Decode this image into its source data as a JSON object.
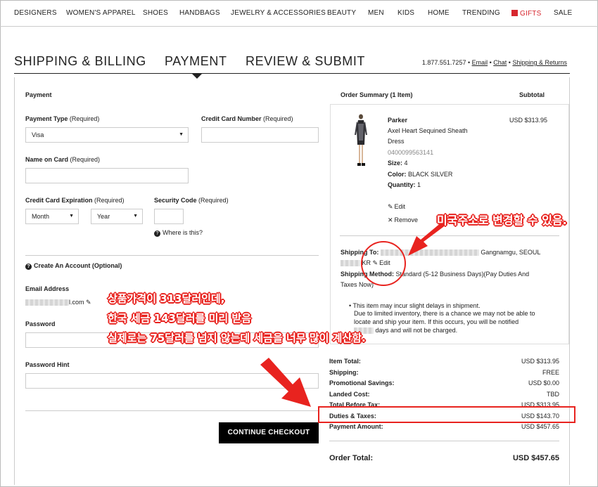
{
  "nav": {
    "items": [
      "DESIGNERS",
      "WOMEN'S APPAREL",
      "SHOES",
      "HANDBAGS",
      "JEWELRY & ACCESSORIES",
      "BEAUTY",
      "MEN",
      "KIDS",
      "HOME",
      "TRENDING"
    ],
    "gifts": "GIFTS",
    "sale": "SALE"
  },
  "steps": {
    "shipping": "SHIPPING & BILLING",
    "payment": "PAYMENT",
    "review": "REVIEW & SUBMIT"
  },
  "contact": {
    "phone": "1.877.551.7257 • ",
    "email": "Email",
    "sep": " • ",
    "chat": "Chat",
    "shipping_returns": "Shipping & Returns"
  },
  "payment": {
    "section_title": "Payment",
    "required": "(Required)",
    "payment_type_label": "Payment Type",
    "payment_type_value": "Visa",
    "card_number_label": "Credit Card Number",
    "name_on_card_label": "Name on Card",
    "expiration_label": "Credit Card Expiration",
    "month": "Month",
    "year": "Year",
    "security_code_label": "Security Code",
    "where_is_this": "Where is this?"
  },
  "account": {
    "title": "Create An Account (Optional)",
    "email_label": "Email Address",
    "email_suffix": "l.com",
    "password_label": "Password",
    "password_hint_label": "Password Hint"
  },
  "continue_button": "CONTINUE CHECKOUT",
  "summary": {
    "title": "Order Summary (1 Item)",
    "subtotal_label": "Subtotal",
    "brand": "Parker",
    "name_line1": "Axel Heart Sequined Sheath",
    "name_line2": "Dress",
    "sku": "0400099563141",
    "size_label": "Size:",
    "size": "4",
    "color_label": "Color:",
    "color": "BLACK SILVER",
    "qty_label": "Quantity:",
    "qty": "1",
    "price": "USD $313.95",
    "edit": "Edit",
    "remove": "Remove",
    "ship_to_label": "Shipping To:",
    "ship_to_city": "Gangnamgu, SEOUL",
    "ship_to_country": "KR",
    "ship_method_label": "Shipping Method:",
    "ship_method_line1": "Standard (5-12 Business Days)(Pay Duties And",
    "ship_method_line2": "Taxes Now)",
    "notice_line1": "This item may incur slight delays in shipment.",
    "notice_line2": "Due to limited inventory, there is a chance we may not be able to",
    "notice_line3": "locate and ship your item. If this occurs, you will be notified",
    "notice_line4": "days and will not be charged."
  },
  "totals": {
    "item_total_label": "Item Total:",
    "item_total": "USD $313.95",
    "shipping_label": "Shipping:",
    "shipping": "FREE",
    "promo_label": "Promotional Savings:",
    "promo": "USD $0.00",
    "landed_label": "Landed Cost:",
    "landed": "TBD",
    "before_tax_label": "Total Before Tax:",
    "before_tax": "USD $313.95",
    "duties_label": "Duties & Taxes:",
    "duties": "USD $143.70",
    "payment_label": "Payment Amount:",
    "payment": "USD $457.65",
    "order_total_label": "Order Total:",
    "order_total": "USD $457.65"
  },
  "annotations": {
    "address_note": "미국주소로 변경할 수 있음.",
    "tax_line1": "상품가격이 313달러인데,",
    "tax_line2": "한국 세금 143달러를 미리 받음",
    "tax_line3": "실제로는 75달러를 넘지 않는데 세금을 너무 많이 계산함."
  },
  "colors": {
    "annotation_red": "#e8231f",
    "gifts_red": "#d7262e",
    "button_black": "#000000"
  }
}
